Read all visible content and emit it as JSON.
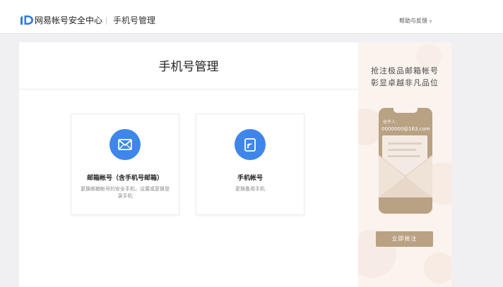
{
  "header": {
    "brand": "网易帐号安全中心",
    "sub_title": "手机号管理",
    "help_label": "帮助与反馈"
  },
  "main": {
    "title": "手机号管理",
    "cards": [
      {
        "title": "邮箱帐号（含手机号邮箱）",
        "desc": "更换邮箱帐号的安全手机，设置或更换登录手机",
        "icon": "envelope-icon"
      },
      {
        "title": "手机帐号",
        "desc": "更换备用手机",
        "icon": "phone-signal-icon"
      }
    ]
  },
  "ad": {
    "slogan_line1": "抢注极品邮箱帐号",
    "slogan_line2": "彰显卓越非凡品位",
    "recipient_label": "收件人：",
    "recipient_email": "0000000@163.com",
    "button_label": "立即抢注"
  },
  "colors": {
    "accent_blue": "#3f86ea",
    "ad_gold": "#b9a183",
    "ad_bg": "#fbf3ee"
  }
}
